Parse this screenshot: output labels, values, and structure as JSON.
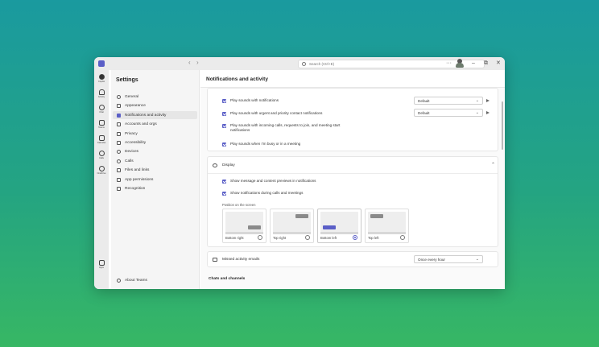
{
  "window": {
    "search_placeholder": "Search (Ctrl+E)",
    "more": "···",
    "minimize": "–",
    "maximize": "⧉",
    "close": "✕"
  },
  "rail": [
    {
      "label": "Copilot",
      "icon": "copilot-icon"
    },
    {
      "label": "Activity",
      "icon": "bell-icon"
    },
    {
      "label": "Chat",
      "icon": "chat-icon"
    },
    {
      "label": "Teams",
      "icon": "teams-icon"
    },
    {
      "label": "Calendar",
      "icon": "calendar-icon"
    },
    {
      "label": "Calls",
      "icon": "call-icon"
    },
    {
      "label": "OneDrive",
      "icon": "cloud-icon"
    },
    {
      "label": "Apps",
      "icon": "apps-icon"
    }
  ],
  "settings": {
    "title": "Settings",
    "items": [
      {
        "label": "General",
        "icon": "gear-icon"
      },
      {
        "label": "Appearance",
        "icon": "brush-icon"
      },
      {
        "label": "Notifications and activity",
        "icon": "bell-icon",
        "active": true
      },
      {
        "label": "Accounts and orgs",
        "icon": "people-icon"
      },
      {
        "label": "Privacy",
        "icon": "lock-icon"
      },
      {
        "label": "Accessibility",
        "icon": "accessibility-icon"
      },
      {
        "label": "Devices",
        "icon": "headset-icon"
      },
      {
        "label": "Calls",
        "icon": "call-icon"
      },
      {
        "label": "Files and links",
        "icon": "folder-icon"
      },
      {
        "label": "App permissions",
        "icon": "apps-icon"
      },
      {
        "label": "Recognition",
        "icon": "badge-icon"
      }
    ],
    "about": "About Teams"
  },
  "main": {
    "title": "Notifications and activity",
    "sounds": {
      "items": [
        "Play sounds with notifications",
        "Play sounds with urgent and priority contact notifications",
        "Play sounds with incoming calls, requests to join, and meeting start notifications",
        "Play sounds when I'm busy or in a meeting"
      ],
      "dropdown_1": "Default",
      "dropdown_2": "Default"
    },
    "display": {
      "label": "Display",
      "items": [
        "Show message and content previews in notifications",
        "Show notifications during calls and meetings"
      ],
      "position_label": "Position on the screen",
      "positions": [
        {
          "label": "Bottom right",
          "selected": false
        },
        {
          "label": "Top right",
          "selected": false
        },
        {
          "label": "Bottom left",
          "selected": true
        },
        {
          "label": "Top left",
          "selected": false
        }
      ]
    },
    "missed": {
      "label": "Missed activity emails",
      "value": "Once every hour"
    },
    "chats_header": "Chats and channels"
  },
  "colors": {
    "accent": "#5b5fc7",
    "background_top": "#1a9a9f",
    "background_bottom": "#37b764"
  }
}
